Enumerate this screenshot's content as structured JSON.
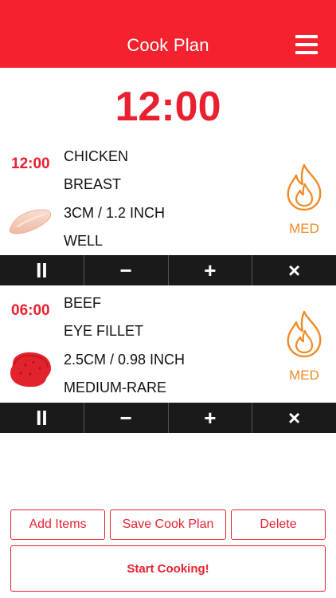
{
  "header": {
    "title": "Cook Plan",
    "menu_icon": "hamburger-menu-icon"
  },
  "main_timer": "12:00",
  "items": [
    {
      "time": "12:00",
      "lines": [
        "CHICKEN",
        "BREAST",
        "3CM / 1.2 INCH",
        "WELL"
      ],
      "heat": "MED",
      "image": "chicken-breast-icon"
    },
    {
      "time": "06:00",
      "lines": [
        "BEEF",
        "EYE FILLET",
        "2.5CM / 0.98 INCH",
        "MEDIUM-RARE"
      ],
      "heat": "MED",
      "image": "beef-steak-icon"
    }
  ],
  "controls": {
    "pause": "II",
    "minus": "−",
    "plus": "+",
    "remove": "×"
  },
  "buttons": {
    "add_items": "Add Items",
    "save_cook_plan": "Save Cook Plan",
    "delete": "Delete",
    "start_cooking": "Start Cooking!"
  },
  "colors": {
    "brand_red": "#f4212e",
    "accent_orange": "#f08a24",
    "control_bar": "#1a1a1a"
  }
}
